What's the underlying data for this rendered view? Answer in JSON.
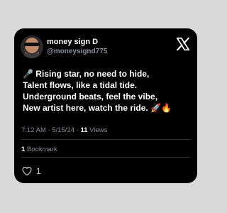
{
  "author": {
    "display_name": "money sign D",
    "handle": "@moneysignd775"
  },
  "tweet": {
    "lines": [
      "🎤 Rising star, no need to hide,",
      "Talent flows, like a tidal tide.",
      "Underground beats, feel the vibe,",
      "New artist here, watch the ride. 🚀🔥"
    ]
  },
  "meta": {
    "time": "7:12 AM",
    "sep1": " · ",
    "date": "5/15/24",
    "sep2": " · ",
    "views_count": "11",
    "views_label": " Views"
  },
  "bookmarks": {
    "count": "1",
    "label": " Bookmark"
  },
  "actions": {
    "like_count": "1"
  },
  "icons": {
    "logo": "x-logo-icon",
    "like": "heart-icon"
  },
  "colors": {
    "background": "#d9d9d9",
    "card": "#000000",
    "text": "#ffffff",
    "secondary_text": "#8a8f96",
    "divider": "#2f3336"
  }
}
